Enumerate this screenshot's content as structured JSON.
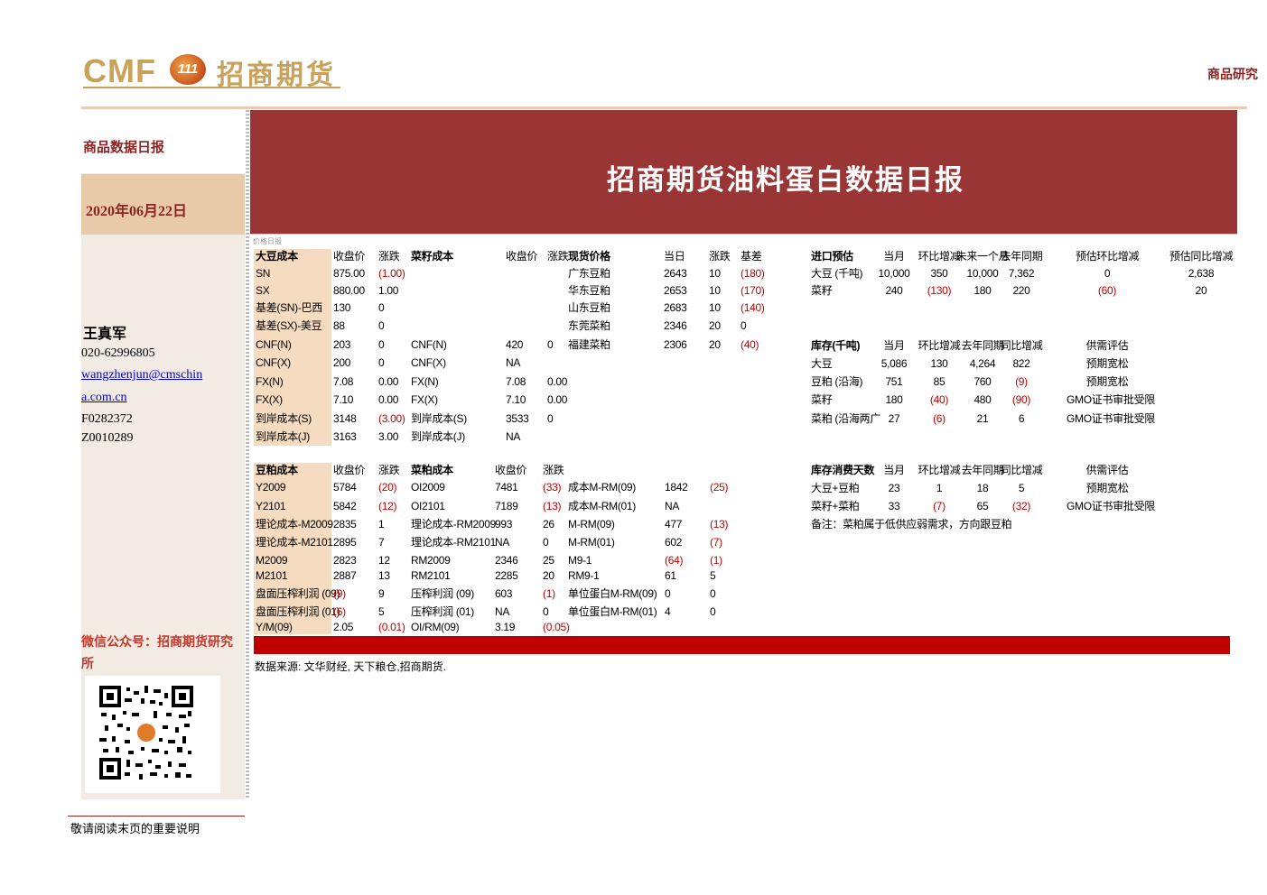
{
  "header": {
    "logo_en": "CMF",
    "logo_badge": "111",
    "logo_cn": "招商期货",
    "top_right": "商品研究"
  },
  "sidebar": {
    "report_type": "商品数据日报",
    "date": "2020年06月22日",
    "author": "王真军",
    "phone": "020-62996805",
    "email_line1": "wangzhenjun@cmschin",
    "email_line2": "a.com.cn",
    "cert1": "F0282372",
    "cert2": "Z0010289",
    "wechat": "微信公众号：招商期货研究所"
  },
  "banner": {
    "title": "招商期货油料蛋白数据日报",
    "tag": "价格日报"
  },
  "tables": {
    "soy_cost": {
      "headers": [
        "大豆成本",
        "收盘价",
        "涨跌"
      ],
      "rows": [
        [
          "SN",
          "875.00",
          "(1.00)"
        ],
        [
          "SX",
          "880.00",
          "1.00"
        ],
        [
          "基差(SN)-巴西",
          "130",
          "0"
        ],
        [
          "基差(SX)-美豆",
          "88",
          "0"
        ],
        [
          "CNF(N)",
          "203",
          "0"
        ],
        [
          "CNF(X)",
          "200",
          "0"
        ],
        [
          "FX(N)",
          "7.08",
          "0.00"
        ],
        [
          "FX(X)",
          "7.10",
          "0.00"
        ],
        [
          "到岸成本(S)",
          "3148",
          "(3.00)"
        ],
        [
          "到岸成本(J)",
          "3163",
          "3.00"
        ]
      ]
    },
    "rapeseed_cost": {
      "headers": [
        "菜籽成本",
        "收盘价",
        "涨跌"
      ],
      "rows": [
        [
          "CNF(N)",
          "420",
          "0"
        ],
        [
          "CNF(X)",
          "NA",
          ""
        ],
        [
          "FX(N)",
          "7.08",
          "0.00"
        ],
        [
          "FX(X)",
          "7.10",
          "0.00"
        ],
        [
          "到岸成本(S)",
          "3533",
          "0"
        ],
        [
          "到岸成本(J)",
          "NA",
          ""
        ]
      ]
    },
    "spot": {
      "headers": [
        "现货价格",
        "当日",
        "涨跌",
        "基差"
      ],
      "rows": [
        [
          "广东豆粕",
          "2643",
          "10",
          "(180)"
        ],
        [
          "华东豆粕",
          "2653",
          "10",
          "(170)"
        ],
        [
          "山东豆粕",
          "2683",
          "10",
          "(140)"
        ],
        [
          "东莞菜粕",
          "2346",
          "20",
          "0"
        ],
        [
          "福建菜粕",
          "2306",
          "20",
          "(40)"
        ]
      ]
    },
    "import": {
      "headers": [
        "进口预估",
        "当月",
        "环比增减",
        "未来一个月",
        "去年同期",
        "预估环比增减",
        "预估同比增减"
      ],
      "rows": [
        [
          "大豆 (千吨)",
          "10,000",
          "350",
          "10,000",
          "7,362",
          "0",
          "2,638"
        ],
        [
          "菜籽",
          "240",
          "(130)",
          "180",
          "220",
          "(60)",
          "20"
        ]
      ]
    },
    "inventory": {
      "headers": [
        "库存(千吨)",
        "当月",
        "环比增减",
        "去年同期",
        "同比增减",
        "供需评估"
      ],
      "rows": [
        [
          "大豆",
          "5,086",
          "130",
          "4,264",
          "822",
          "预期宽松"
        ],
        [
          "豆粕 (沿海)",
          "751",
          "85",
          "760",
          "(9)",
          "预期宽松"
        ],
        [
          "菜籽",
          "180",
          "(40)",
          "480",
          "(90)",
          "GMO证书审批受限"
        ],
        [
          "菜粕 (沿海两广",
          "27",
          "(6)",
          "21",
          "6",
          "GMO证书审批受限"
        ]
      ]
    },
    "meal_cost": {
      "headers": [
        "豆粕成本",
        "收盘价",
        "涨跌"
      ],
      "rows": [
        [
          "Y2009",
          "5784",
          "(20)"
        ],
        [
          "Y2101",
          "5842",
          "(12)"
        ],
        [
          "理论成本-M2009",
          "2835",
          "1"
        ],
        [
          "理论成本-M2101",
          "2895",
          "7"
        ],
        [
          "M2009",
          "2823",
          "12"
        ],
        [
          "M2101",
          "2887",
          "13"
        ],
        [
          "盘面压榨利润 (09)",
          "(9)",
          "9"
        ],
        [
          "盘面压榨利润 (01)",
          "(6)",
          "5"
        ],
        [
          "Y/M(09)",
          "2.05",
          "(0.01)"
        ]
      ]
    },
    "rapemeal_cost": {
      "headers": [
        "菜粕成本",
        "收盘价",
        "涨跌"
      ],
      "rows": [
        [
          "OI2009",
          "7481",
          "(33)"
        ],
        [
          "OI2101",
          "7189",
          "(13)"
        ],
        [
          "理论成本-RM2009",
          "993",
          "26"
        ],
        [
          "理论成本-RM2101",
          "NA",
          "0"
        ],
        [
          "RM2009",
          "2346",
          "25"
        ],
        [
          "RM2101",
          "2285",
          "20"
        ],
        [
          "压榨利润 (09)",
          "603",
          "(1)"
        ],
        [
          "压榨利润 (01)",
          "NA",
          "0"
        ],
        [
          "OI/RM(09)",
          "3.19",
          "(0.05)"
        ]
      ]
    },
    "spread": {
      "rows": [
        [
          "成本M-RM(09)",
          "1842",
          "(25)"
        ],
        [
          "成本M-RM(01)",
          "NA",
          ""
        ],
        [
          "M-RM(09)",
          "477",
          "(13)"
        ],
        [
          "M-RM(01)",
          "602",
          "(7)"
        ],
        [
          "M9-1",
          "(64)",
          "(1)"
        ],
        [
          "RM9-1",
          "61",
          "5"
        ],
        [
          "单位蛋白M-RM(09)",
          "0",
          "0"
        ],
        [
          "单位蛋白M-RM(01)",
          "4",
          "0"
        ]
      ]
    },
    "days": {
      "headers": [
        "库存消费天数",
        "当月",
        "环比增减",
        "去年同期",
        "同比增减",
        "供需评估"
      ],
      "rows": [
        [
          "大豆+豆粕",
          "23",
          "1",
          "18",
          "5",
          "预期宽松"
        ],
        [
          "菜籽+菜粕",
          "33",
          "(7)",
          "65",
          "(32)",
          "GMO证书审批受限"
        ]
      ],
      "note": "备注：菜粕属于低供应弱需求，方向跟豆粕"
    }
  },
  "source": "数据来源: 文华财经, 天下粮仓,招商期货."
}
